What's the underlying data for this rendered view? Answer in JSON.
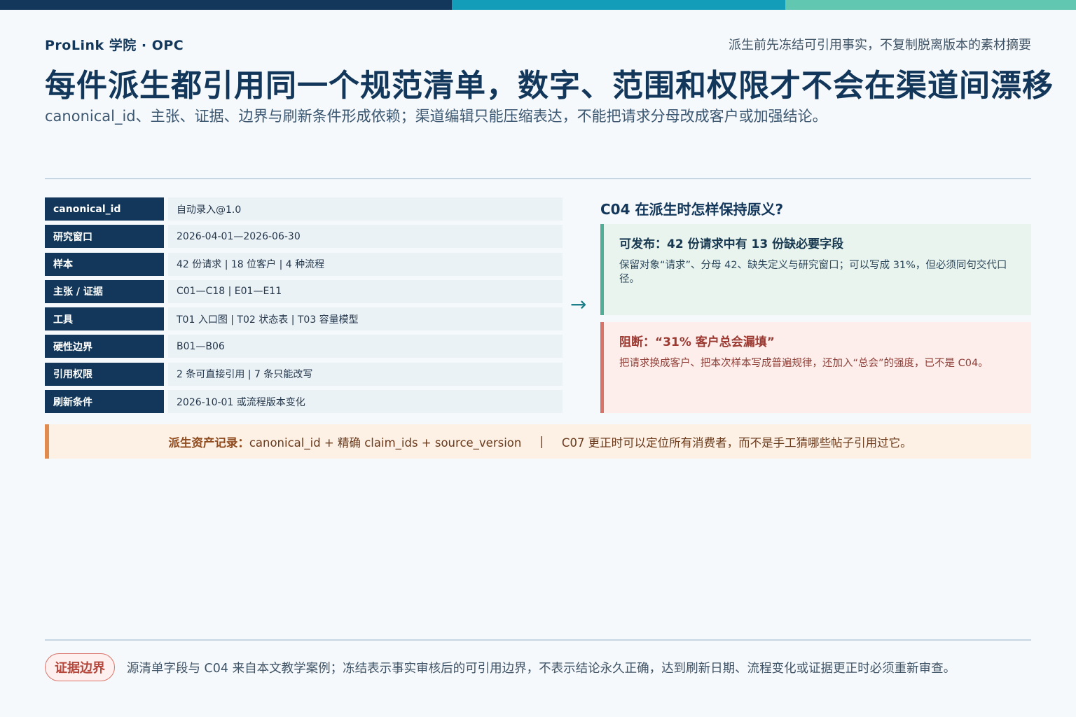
{
  "header": {
    "brand": "ProLink 学院 · OPC",
    "tagline": "派生前先冻结可引用事实，不复制脱离版本的素材摘要",
    "title": "每件派生都引用同一个规范清单，数字、范围和权限才不会在渠道间漂移",
    "subtitle": "canonical_id、主张、证据、边界与刷新条件形成依赖；渠道编辑只能压缩表达，不能把请求分母改成客户或加强结论。"
  },
  "table": {
    "rows": [
      {
        "key": "canonical_id",
        "value": "自动录入@1.0"
      },
      {
        "key": "研究窗口",
        "value": "2026-04-01—2026-06-30"
      },
      {
        "key": "样本",
        "value": "42 份请求 | 18 位客户 | 4 种流程"
      },
      {
        "key": "主张 / 证据",
        "value": "C01—C18 | E01—E11"
      },
      {
        "key": "工具",
        "value": "T01 入口图 | T02 状态表 | T03 容量模型"
      },
      {
        "key": "硬性边界",
        "value": "B01—B06"
      },
      {
        "key": "引用权限",
        "value": "2 条可直接引用 | 7 条只能改写"
      },
      {
        "key": "刷新条件",
        "value": "2026-10-01 或流程版本变化"
      }
    ]
  },
  "arrow": "→",
  "right_panel": {
    "title": "C04 在派生时怎样保持原义?",
    "ok_card": {
      "title": "可发布：42 份请求中有 13 份缺必要字段",
      "body": "保留对象“请求”、分母 42、缺失定义与研究窗口；可以写成 31%，但必须同句交代口径。"
    },
    "bad_card": {
      "title": "阻断：“31% 客户总会漏填”",
      "body": "把请求换成客户、把本次样本写成普遍规律，还加入“总会”的强度，已不是 C04。"
    }
  },
  "record": {
    "label": "派生资产记录：",
    "formula": "canonical_id + 精确 claim_ids + source_version",
    "separator": "|",
    "note": "C07 更正时可以定位所有消费者，而不是手工猜哪些帖子引用过它。"
  },
  "footer": {
    "badge": "证据边界",
    "note": "源清单字段与 C04 来自本文教学案例；冻结表示事实审核后的可引用边界，不表示结论永久正确，达到刷新日期、流程变化或证据更正时必须重新审查。"
  }
}
